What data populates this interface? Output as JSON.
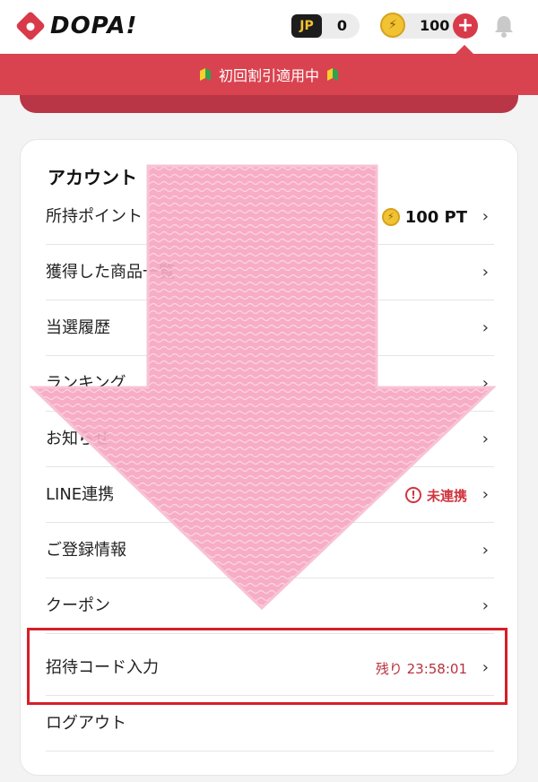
{
  "header": {
    "logo_text": "DOPA!",
    "jp_label": "JP",
    "jp_value": "0",
    "coin_value": "100",
    "plus_symbol": "+",
    "icons": [
      "logo-icon",
      "jp-icon",
      "coin-icon",
      "plus-icon",
      "bell-icon"
    ]
  },
  "banner": {
    "text": "初回割引適用中"
  },
  "account": {
    "title": "アカウント",
    "items": [
      {
        "label": "所持ポイント",
        "value": "100 PT"
      },
      {
        "label": "獲得した商品一覧"
      },
      {
        "label": "当選履歴"
      },
      {
        "label": "ランキング"
      },
      {
        "label": "お知らせ"
      },
      {
        "label": "LINE連携",
        "status": "未連携"
      },
      {
        "label": "ご登録情報"
      },
      {
        "label": "クーポン"
      },
      {
        "label": "招待コード入力",
        "countdown": "残り 23:58:01"
      },
      {
        "label": "ログアウト"
      }
    ]
  },
  "colors": {
    "brand_red": "#d9434f",
    "highlight_red": "#d51f27",
    "arrow_pink": "#f6a6c1"
  }
}
